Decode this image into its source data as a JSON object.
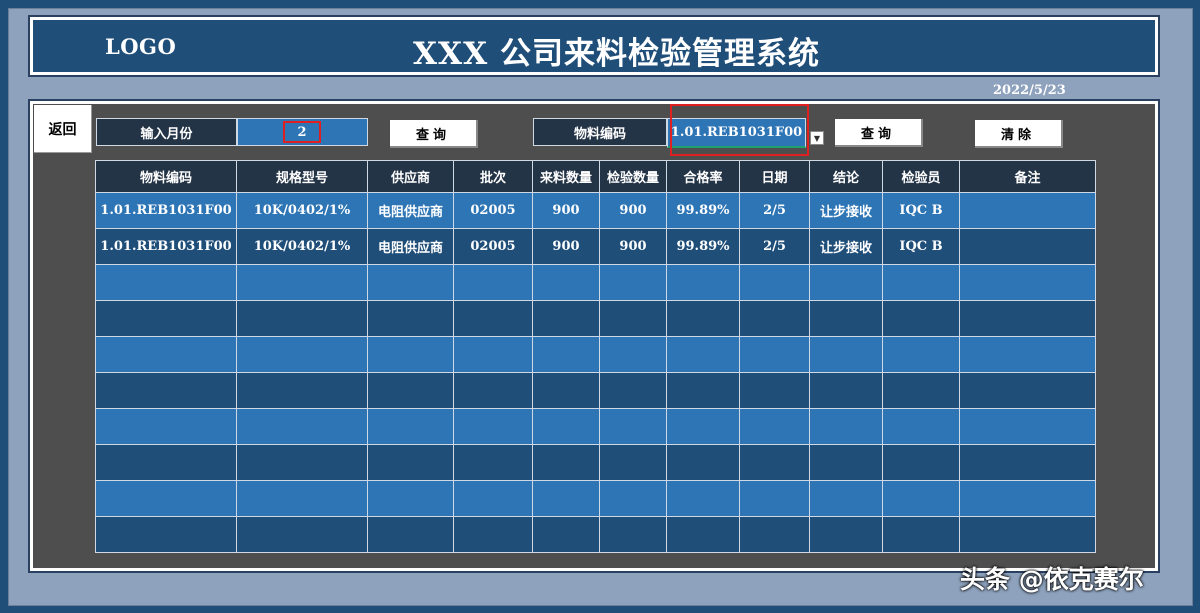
{
  "header": {
    "logo_text": "LOGO",
    "app_title": "XXX 公司来料检验管理系统",
    "date": "2022/5/23"
  },
  "toolbar": {
    "back_label": "返回",
    "month_label": "输入月份",
    "month_value": "2",
    "query_label": "查询",
    "material_label": "物料编码",
    "material_value": "1.01.REB1031F00",
    "clear_label": "清除"
  },
  "table": {
    "columns": [
      "物料编码",
      "规格型号",
      "供应商",
      "批次",
      "来料数量",
      "检验数量",
      "合格率",
      "日期",
      "结论",
      "检验员",
      "备注"
    ],
    "rows": [
      [
        "1.01.REB1031F00",
        "10K/0402/1%",
        "电阻供应商",
        "02005",
        "900",
        "900",
        "99.89%",
        "2/5",
        "让步接收",
        "IQC B",
        ""
      ],
      [
        "1.01.REB1031F00",
        "10K/0402/1%",
        "电阻供应商",
        "02005",
        "900",
        "900",
        "99.89%",
        "2/5",
        "让步接收",
        "IQC B",
        ""
      ]
    ],
    "empty_rows": 8
  },
  "watermark": "头条 @依克赛尔",
  "colors": {
    "background": "#1f4e79",
    "frame": "#8ea2bd",
    "panel": "#4e4e4e",
    "header_cell": "#243447",
    "row_light": "#2e75b6",
    "row_dark": "#1f4e79",
    "highlight": "#e02020"
  }
}
